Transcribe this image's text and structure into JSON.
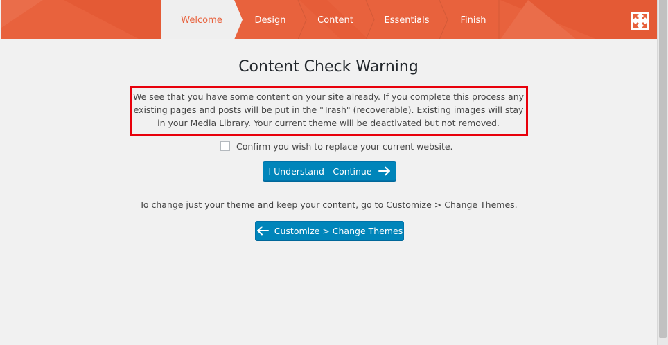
{
  "header": {
    "accent_color": "#e8623d",
    "steps": [
      {
        "label": "Welcome",
        "active": true
      },
      {
        "label": "Design",
        "active": false
      },
      {
        "label": "Content",
        "active": false
      },
      {
        "label": "Essentials",
        "active": false
      },
      {
        "label": "Finish",
        "active": false
      }
    ],
    "expand_icon": "expand-arrows-icon"
  },
  "main": {
    "title": "Content Check Warning",
    "warning_text": "We see that you have some content on your site already. If you complete this process any existing pages and posts will be put in the \"Trash\" (recoverable). Existing images will stay in your Media Library. Your current theme will be deactivated but not removed.",
    "warning_border_color": "#e8000b",
    "confirm_label": "Confirm you wish to replace your current website.",
    "confirm_checked": false,
    "continue_button": "I Understand - Continue",
    "continue_icon": "arrow-right-icon",
    "note": "To change just your theme and keep your content, go to Customize > Change Themes.",
    "customize_button": "Customize > Change Themes",
    "customize_icon": "arrow-left-icon",
    "button_color": "#0085ba"
  }
}
